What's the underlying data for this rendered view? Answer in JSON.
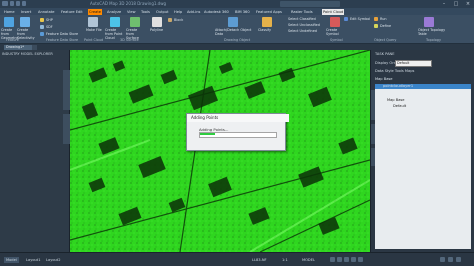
{
  "app": {
    "title": "AutoCAD Map 3D 2018  Drawing1.dwg",
    "window_controls": [
      "–",
      "□",
      "×"
    ]
  },
  "ribbon_tabs": [
    {
      "label": "Home"
    },
    {
      "label": "Insert"
    },
    {
      "label": "Annotate"
    },
    {
      "label": "Feature Edit"
    },
    {
      "label": "Create",
      "state": "active"
    },
    {
      "label": "Analyze"
    },
    {
      "label": "View"
    },
    {
      "label": "Tools"
    },
    {
      "label": "Output"
    },
    {
      "label": "Help"
    },
    {
      "label": "Add-ins"
    },
    {
      "label": "Autodesk 360"
    },
    {
      "label": "BIM 360"
    },
    {
      "label": "Featured Apps"
    },
    {
      "label": "Raster Tools"
    },
    {
      "label": "Point Cloud",
      "state": "active2"
    }
  ],
  "ribbon": {
    "panels": [
      {
        "title": "Feature"
      },
      {
        "title": "Feature Data Store"
      },
      {
        "title": "Point Cloud"
      },
      {
        "title": "3D Surface"
      },
      {
        "title": "Drawing Object"
      },
      {
        "title": "Symbol"
      },
      {
        "title": "Object Query"
      },
      {
        "title": "Topology"
      }
    ],
    "buttons": [
      {
        "label": "Create from Geometry",
        "color": "#4fa3e0"
      },
      {
        "label": "Create from Selectivity",
        "color": "#6ab0e8"
      },
      {
        "label": "SHP",
        "color": "#e8c54a"
      },
      {
        "label": "SDF",
        "color": "#8fb8d8"
      },
      {
        "label": "Feature Data Store",
        "color": "#5a9ad6"
      },
      {
        "label": "Make File",
        "color": "#b0c4d6"
      },
      {
        "label": "Create from Point Cloud",
        "color": "#4cc3e8"
      },
      {
        "label": "Create from Surface",
        "color": "#6fbf6f"
      },
      {
        "label": "Polyline",
        "color": "#e0e0e0"
      },
      {
        "label": "Block",
        "color": "#c9a86b"
      },
      {
        "label": "Attach/Detach Object Data",
        "color": "#5d9cd2"
      },
      {
        "label": "Classify",
        "color": "#e6b24a"
      },
      {
        "label": "Create Symbol",
        "color": "#d65a5a"
      },
      {
        "label": "Edit Symbol",
        "color": "#5a8ad6"
      },
      {
        "label": "Run",
        "color": "#e8a13a"
      },
      {
        "label": "Define",
        "color": "#d6d65a"
      },
      {
        "label": "Object Topology Table",
        "color": "#9a7ad6"
      }
    ],
    "list_items": [
      "Select Classified",
      "Select Unclassified",
      "Select Undefined",
      "Classify",
      "Insert Symbol",
      "Edit Symbol"
    ]
  },
  "file_tab": {
    "label": "Drawing1*"
  },
  "left_palette": {
    "title": "INDUSTRY MODEL EXPLORER"
  },
  "dialog": {
    "title": "Adding Points",
    "message": "Adding Points...",
    "progress": 0.2
  },
  "right_palette": {
    "title": "TASK PANE",
    "display_label": "Display Order",
    "display_value": "Default",
    "toolbar_label": "Data  Style  Tools  Maps",
    "tree": [
      {
        "label": "Map Base"
      },
      {
        "label": "pointcloudlayer1",
        "selected": true
      },
      {
        "label": "Map Base"
      },
      {
        "label": "Default"
      }
    ],
    "vertical_tabs": [
      "Map Explorer",
      "Map Book",
      "Survey"
    ]
  },
  "status_bar": {
    "tabs": [
      {
        "label": "Model",
        "state": "active"
      },
      {
        "label": "Layout1"
      },
      {
        "label": "Layout2"
      }
    ],
    "scale": "1:1",
    "coord": "LL83-NF",
    "model_label": "MODEL"
  }
}
